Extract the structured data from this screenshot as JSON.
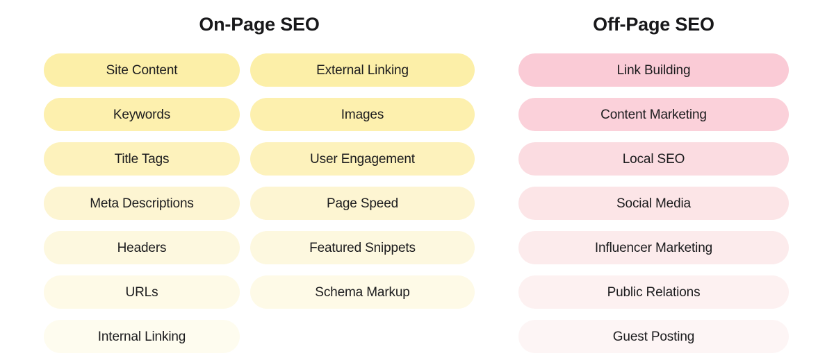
{
  "sections": [
    {
      "id": "on-page-seo",
      "title": "On-Page SEO",
      "accent": "#FCEFA8",
      "columns": [
        {
          "id": "on-page-column-a",
          "items": [
            {
              "label": "Site Content",
              "color": "#FCEFA8"
            },
            {
              "label": "Keywords",
              "color": "#FDF0AE"
            },
            {
              "label": "Title Tags",
              "color": "#FDF2BC"
            },
            {
              "label": "Meta Descriptions",
              "color": "#FDF5D2"
            },
            {
              "label": "Headers",
              "color": "#FDF8DF"
            },
            {
              "label": "URLs",
              "color": "#FEFAE7"
            },
            {
              "label": "Internal Linking",
              "color": "#FEFCEF"
            }
          ]
        },
        {
          "id": "on-page-column-b",
          "items": [
            {
              "label": "External Linking",
              "color": "#FCEFA8"
            },
            {
              "label": "Images",
              "color": "#FDF0AE"
            },
            {
              "label": "User Engagement",
              "color": "#FDF2BC"
            },
            {
              "label": "Page Speed",
              "color": "#FDF5D2"
            },
            {
              "label": "Featured Snippets",
              "color": "#FDF8DF"
            },
            {
              "label": "Schema Markup",
              "color": "#FEFAE7"
            }
          ]
        }
      ]
    },
    {
      "id": "off-page-seo",
      "title": "Off-Page SEO",
      "accent": "#FACBD6",
      "columns": [
        {
          "id": "off-page-column-a",
          "items": [
            {
              "label": "Link Building",
              "color": "#FACBD6"
            },
            {
              "label": "Content Marketing",
              "color": "#FBD1DA"
            },
            {
              "label": "Local SEO",
              "color": "#FBDCE1"
            },
            {
              "label": "Social Media",
              "color": "#FCE5E7"
            },
            {
              "label": "Influencer Marketing",
              "color": "#FCEBEC"
            },
            {
              "label": "Public Relations",
              "color": "#FDF1F1"
            },
            {
              "label": "Guest Posting",
              "color": "#FDF5F5"
            }
          ]
        }
      ]
    }
  ]
}
